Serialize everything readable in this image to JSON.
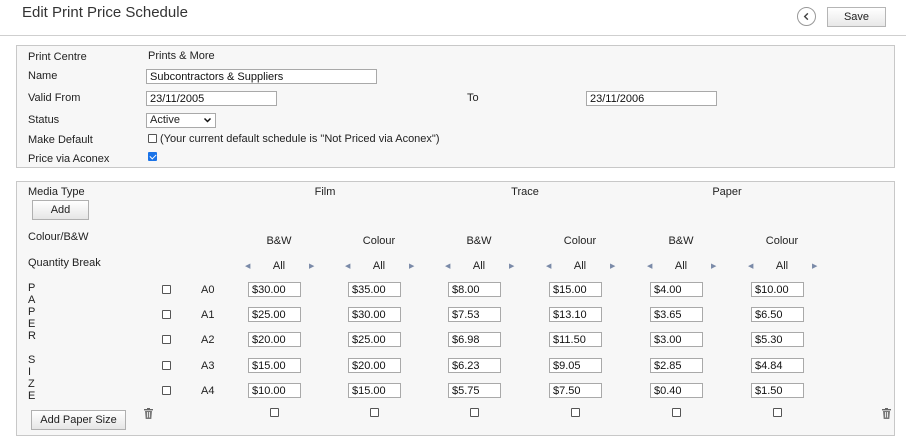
{
  "header": {
    "title": "Edit Print Price Schedule",
    "save_label": "Save"
  },
  "details": {
    "print_centre_label": "Print Centre",
    "print_centre_value": "Prints & More",
    "name_label": "Name",
    "name_value": "Subcontractors & Suppliers",
    "valid_from_label": "Valid From",
    "valid_from_value": "23/11/2005",
    "to_label": "To",
    "to_value": "23/11/2006",
    "status_label": "Status",
    "status_value": "Active",
    "make_default_label": "Make Default",
    "make_default_checked": false,
    "make_default_note": "(Your current default schedule is \"Not Priced via Aconex\")",
    "price_via_label": "Price via Aconex",
    "price_via_checked": true
  },
  "schedule": {
    "media_type_label": "Media Type",
    "add_label": "Add",
    "colour_bw_label": "Colour/B&W",
    "quantity_break_label": "Quantity Break",
    "paper_letters": [
      "P",
      "A",
      "P",
      "E",
      "R"
    ],
    "size_letters": [
      "S",
      "I",
      "Z",
      "E"
    ],
    "media_types": [
      "Film",
      "Trace",
      "Paper"
    ],
    "column_modes": [
      "B&W",
      "Colour",
      "B&W",
      "Colour",
      "B&W",
      "Colour"
    ],
    "quantity_value": "All",
    "sizes": [
      "A0",
      "A1",
      "A2",
      "A3",
      "A4"
    ],
    "prices": [
      [
        "$30.00",
        "$35.00",
        "$8.00",
        "$15.00",
        "$4.00",
        "$10.00"
      ],
      [
        "$25.00",
        "$30.00",
        "$7.53",
        "$13.10",
        "$3.65",
        "$6.50"
      ],
      [
        "$20.00",
        "$25.00",
        "$6.98",
        "$11.50",
        "$3.00",
        "$5.30"
      ],
      [
        "$15.00",
        "$20.00",
        "$6.23",
        "$9.05",
        "$2.85",
        "$4.84"
      ],
      [
        "$10.00",
        "$15.00",
        "$5.75",
        "$7.50",
        "$0.40",
        "$1.50"
      ]
    ],
    "add_paper_size_label": "Add Paper Size"
  },
  "icons": {
    "back": "chevron-left-icon",
    "delete": "trash-icon",
    "prev": "caret-left-icon",
    "next": "caret-right-icon",
    "dropdown": "chevron-down-icon"
  },
  "colors": {
    "checkbox_accent": "#1a73e8",
    "panel_background": "#f7f7f7",
    "panel_border": "#c8c8c8"
  }
}
